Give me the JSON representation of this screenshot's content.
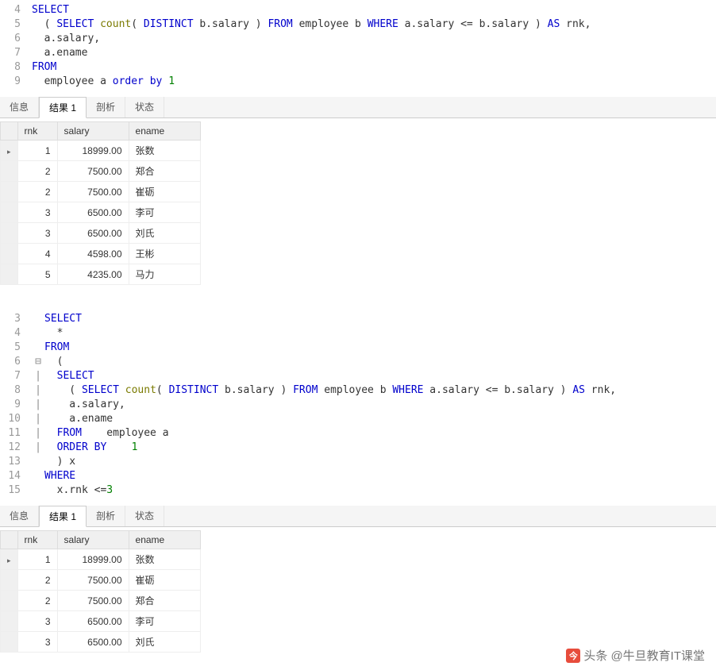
{
  "editor1": {
    "lines": [
      {
        "n": 4,
        "tokens": [
          {
            "t": "SELECT",
            "c": "kw"
          }
        ]
      },
      {
        "n": 5,
        "tokens": [
          {
            "t": "  ( ",
            "c": ""
          },
          {
            "t": "SELECT",
            "c": "kw"
          },
          {
            "t": " ",
            "c": ""
          },
          {
            "t": "count",
            "c": "fn"
          },
          {
            "t": "( ",
            "c": ""
          },
          {
            "t": "DISTINCT",
            "c": "kw"
          },
          {
            "t": " b.salary ) ",
            "c": ""
          },
          {
            "t": "FROM",
            "c": "kw"
          },
          {
            "t": " employee b ",
            "c": ""
          },
          {
            "t": "WHERE",
            "c": "kw"
          },
          {
            "t": " a.salary <= b.salary ) ",
            "c": ""
          },
          {
            "t": "AS",
            "c": "kw"
          },
          {
            "t": " rnk,",
            "c": ""
          }
        ]
      },
      {
        "n": 6,
        "tokens": [
          {
            "t": "  a.salary,",
            "c": ""
          }
        ]
      },
      {
        "n": 7,
        "tokens": [
          {
            "t": "  a.ename",
            "c": ""
          }
        ]
      },
      {
        "n": 8,
        "tokens": [
          {
            "t": "FROM",
            "c": "kw"
          }
        ]
      },
      {
        "n": 9,
        "tokens": [
          {
            "t": "  employee a ",
            "c": ""
          },
          {
            "t": "order by",
            "c": "kw"
          },
          {
            "t": " ",
            "c": ""
          },
          {
            "t": "1",
            "c": "num"
          }
        ]
      }
    ]
  },
  "tabs": {
    "info": "信息",
    "result1": "结果 1",
    "analyze": "剖析",
    "status": "状态"
  },
  "grid": {
    "headers": {
      "rnk": "rnk",
      "salary": "salary",
      "ename": "ename"
    }
  },
  "result1_rows": [
    {
      "rnk": "1",
      "salary": "18999.00",
      "ename": "张数"
    },
    {
      "rnk": "2",
      "salary": "7500.00",
      "ename": "郑合"
    },
    {
      "rnk": "2",
      "salary": "7500.00",
      "ename": "崔砺"
    },
    {
      "rnk": "3",
      "salary": "6500.00",
      "ename": "李可"
    },
    {
      "rnk": "3",
      "salary": "6500.00",
      "ename": "刘氏"
    },
    {
      "rnk": "4",
      "salary": "4598.00",
      "ename": "王彬"
    },
    {
      "rnk": "5",
      "salary": "4235.00",
      "ename": "马力"
    }
  ],
  "editor2": {
    "lines": [
      {
        "n": 3,
        "fold": "",
        "tokens": [
          {
            "t": "SELECT",
            "c": "kw"
          }
        ]
      },
      {
        "n": 4,
        "fold": "",
        "tokens": [
          {
            "t": "  *",
            "c": ""
          }
        ]
      },
      {
        "n": 5,
        "fold": "",
        "tokens": [
          {
            "t": "FROM",
            "c": "kw"
          }
        ]
      },
      {
        "n": 6,
        "fold": "⊟",
        "tokens": [
          {
            "t": "  (",
            "c": ""
          }
        ]
      },
      {
        "n": 7,
        "fold": "|",
        "tokens": [
          {
            "t": "  ",
            "c": ""
          },
          {
            "t": "SELECT",
            "c": "kw"
          }
        ]
      },
      {
        "n": 8,
        "fold": "|",
        "tokens": [
          {
            "t": "    ( ",
            "c": ""
          },
          {
            "t": "SELECT",
            "c": "kw"
          },
          {
            "t": " ",
            "c": ""
          },
          {
            "t": "count",
            "c": "fn"
          },
          {
            "t": "( ",
            "c": ""
          },
          {
            "t": "DISTINCT",
            "c": "kw"
          },
          {
            "t": " b.salary ) ",
            "c": ""
          },
          {
            "t": "FROM",
            "c": "kw"
          },
          {
            "t": " employee b ",
            "c": ""
          },
          {
            "t": "WHERE",
            "c": "kw"
          },
          {
            "t": " a.salary <= b.salary ) ",
            "c": ""
          },
          {
            "t": "AS",
            "c": "kw"
          },
          {
            "t": " rnk,",
            "c": ""
          }
        ]
      },
      {
        "n": 9,
        "fold": "|",
        "tokens": [
          {
            "t": "    a.salary,",
            "c": ""
          }
        ]
      },
      {
        "n": 10,
        "fold": "|",
        "tokens": [
          {
            "t": "    a.ename",
            "c": ""
          }
        ]
      },
      {
        "n": 11,
        "fold": "|",
        "tokens": [
          {
            "t": "  ",
            "c": ""
          },
          {
            "t": "FROM",
            "c": "kw"
          },
          {
            "t": "    employee a",
            "c": ""
          }
        ]
      },
      {
        "n": 12,
        "fold": "|",
        "tokens": [
          {
            "t": "  ",
            "c": ""
          },
          {
            "t": "ORDER BY",
            "c": "kw"
          },
          {
            "t": "    ",
            "c": ""
          },
          {
            "t": "1",
            "c": "num"
          }
        ]
      },
      {
        "n": 13,
        "fold": "",
        "tokens": [
          {
            "t": "  ) x",
            "c": ""
          }
        ]
      },
      {
        "n": 14,
        "fold": "",
        "tokens": [
          {
            "t": "WHERE",
            "c": "kw"
          }
        ]
      },
      {
        "n": 15,
        "fold": "",
        "tokens": [
          {
            "t": "  x.rnk <=",
            "c": ""
          },
          {
            "t": "3",
            "c": "num"
          }
        ]
      }
    ]
  },
  "result2_rows": [
    {
      "rnk": "1",
      "salary": "18999.00",
      "ename": "张数"
    },
    {
      "rnk": "2",
      "salary": "7500.00",
      "ename": "崔砺"
    },
    {
      "rnk": "2",
      "salary": "7500.00",
      "ename": "郑合"
    },
    {
      "rnk": "3",
      "salary": "6500.00",
      "ename": "李可"
    },
    {
      "rnk": "3",
      "salary": "6500.00",
      "ename": "刘氏"
    }
  ],
  "watermark": {
    "prefix": "头条",
    "author": "@牛旦教育IT课堂"
  }
}
